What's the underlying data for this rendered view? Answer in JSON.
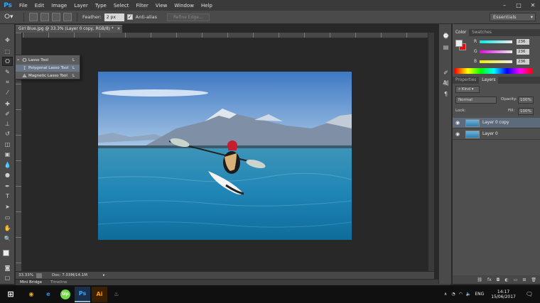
{
  "app": {
    "logo": "Ps",
    "brand_color": "#31a8ff"
  },
  "menu": [
    "File",
    "Edit",
    "Image",
    "Layer",
    "Type",
    "Select",
    "Filter",
    "View",
    "Window",
    "Help"
  ],
  "options": {
    "feather_label": "Feather:",
    "feather_value": "2 px",
    "antialias_label": "Anti-alias",
    "refine_label": "Refine Edge...",
    "workspace": "Essentials"
  },
  "document": {
    "tab_title": "Girl Blue.jpg @ 33.3% (Layer 0 copy, RGB/8) *",
    "zoom": "33.33%",
    "doc_size": "Doc: 7.03M/14.1M"
  },
  "flyout": [
    {
      "label": "Lasso Tool",
      "key": "L",
      "selected": true
    },
    {
      "label": "Polygonal Lasso Tool",
      "key": "L",
      "selected": false
    },
    {
      "label": "Magnetic Lasso Tool",
      "key": "L",
      "selected": false
    }
  ],
  "bottom_tabs": [
    "Mini Bridge",
    "Timeline"
  ],
  "color_panel": {
    "tabs": [
      "Color",
      "Swatches"
    ],
    "channels": [
      {
        "name": "R",
        "value": "236",
        "bar": "#e04040"
      },
      {
        "name": "G",
        "value": "236",
        "bar": "#40c040"
      },
      {
        "name": "B",
        "value": "236",
        "bar": "#4060e0"
      }
    ]
  },
  "layers_panel": {
    "tabs": [
      "Properties",
      "Layers"
    ],
    "kind": "Kind",
    "blend_mode": "Normal",
    "opacity_label": "Opacity:",
    "opacity": "100%",
    "lock_label": "Lock:",
    "fill_label": "Fill:",
    "fill": "100%",
    "layers": [
      {
        "name": "Layer 0 copy",
        "selected": true
      },
      {
        "name": "Layer 0",
        "selected": false
      }
    ]
  },
  "taskbar": {
    "lang": "ENG",
    "time": "14:17",
    "date": "15/06/2017",
    "apps": [
      {
        "icon": "chrome-icon",
        "glyph": "◉",
        "color": "#e8b020"
      },
      {
        "icon": "edge-icon",
        "glyph": "e",
        "color": "#2a8fe0"
      },
      {
        "icon": "upwork-icon",
        "glyph": "Up",
        "color": "#6fda44"
      },
      {
        "icon": "photoshop-icon",
        "glyph": "Ps",
        "color": "#31a8ff"
      },
      {
        "icon": "illustrator-icon",
        "glyph": "Ai",
        "color": "#ff9a00"
      },
      {
        "icon": "steam-icon",
        "glyph": "♨",
        "color": "#8ab4d8"
      }
    ]
  }
}
